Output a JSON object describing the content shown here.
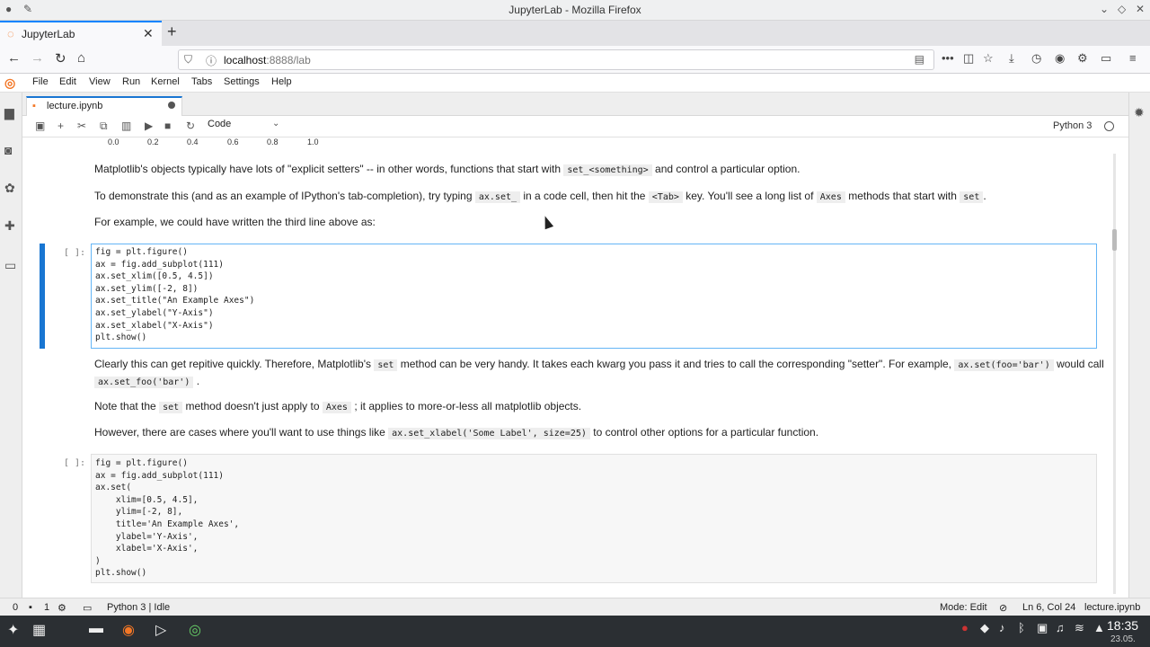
{
  "window": {
    "title": "JupyterLab - Mozilla Firefox"
  },
  "browser": {
    "tab_label": "JupyterLab",
    "url_host": "localhost",
    "url_path": ":8888/lab"
  },
  "jupyter_menu": [
    "File",
    "Edit",
    "View",
    "Run",
    "Kernel",
    "Tabs",
    "Settings",
    "Help"
  ],
  "notebook": {
    "tab_label": "lecture.ipynb",
    "cell_type": "Code",
    "kernel": "Python 3"
  },
  "axis_ticks": [
    "0.0",
    "0.2",
    "0.4",
    "0.6",
    "0.8",
    "1.0"
  ],
  "md1": {
    "p1_a": "Matplotlib's objects typically have lots of \"explicit setters\" -- in other words, functions that start with",
    "p1_code": "set_<something>",
    "p1_b": "and control a particular option.",
    "p2_a": "To demonstrate this (and as an example of IPython's tab-completion), try typing",
    "p2_code1": "ax.set_",
    "p2_b": "in a code cell, then hit the",
    "p2_code2": "<Tab>",
    "p2_c": "key. You'll see a long list of",
    "p2_code3": "Axes",
    "p2_d": "methods that start with",
    "p2_code4": "set",
    "p2_e": ".",
    "p3": "For example, we could have written the third line above as:"
  },
  "cell1": {
    "prompt": "[ ]:",
    "lines": [
      "fig = plt.figure()",
      "ax = fig.add_subplot(111)",
      "ax.set_xlim([0.5, 4.5])",
      "ax.set_ylim([-2, 8])",
      "ax.set_title(\"An Example Axes\")",
      "ax.set_ylabel(\"Y-Axis\")",
      "ax.set_xlabel(\"X-Axis\")",
      "plt.show()"
    ]
  },
  "md2": {
    "p1_a": "Clearly this can get repitive quickly. Therefore, Matplotlib's",
    "p1_code1": "set",
    "p1_b": "method can be very handy. It takes each kwarg you pass it and tries to call the corresponding \"setter\". For example,",
    "p1_code2": "ax.set(foo='bar')",
    "p1_c": "would call",
    "p1_code3": "ax.set_foo('bar')",
    "p1_d": ".",
    "p2_a": "Note that the",
    "p2_code1": "set",
    "p2_b": "method doesn't just apply to",
    "p2_code2": "Axes",
    "p2_c": "; it applies to more-or-less all matplotlib objects.",
    "p3_a": "However, there are cases where you'll want to use things like",
    "p3_code": "ax.set_xlabel('Some Label', size=25)",
    "p3_b": "to control other options for a particular function."
  },
  "cell2": {
    "prompt": "[ ]:",
    "lines": [
      "fig = plt.figure()",
      "ax = fig.add_subplot(111)",
      "ax.set(",
      "    xlim=[0.5, 4.5],",
      "    ylim=[-2, 8],",
      "    title='An Example Axes',",
      "    ylabel='Y-Axis',",
      "    xlabel='X-Axis',",
      ")",
      "plt.show()"
    ]
  },
  "status": {
    "left_count1": "0",
    "left_count2": "1",
    "kernel_status": "Python 3 | Idle",
    "mode": "Mode: Edit",
    "position": "Ln 6, Col 24",
    "filename": "lecture.ipynb"
  },
  "taskbar": {
    "time": "18:35",
    "date": "23.05."
  }
}
